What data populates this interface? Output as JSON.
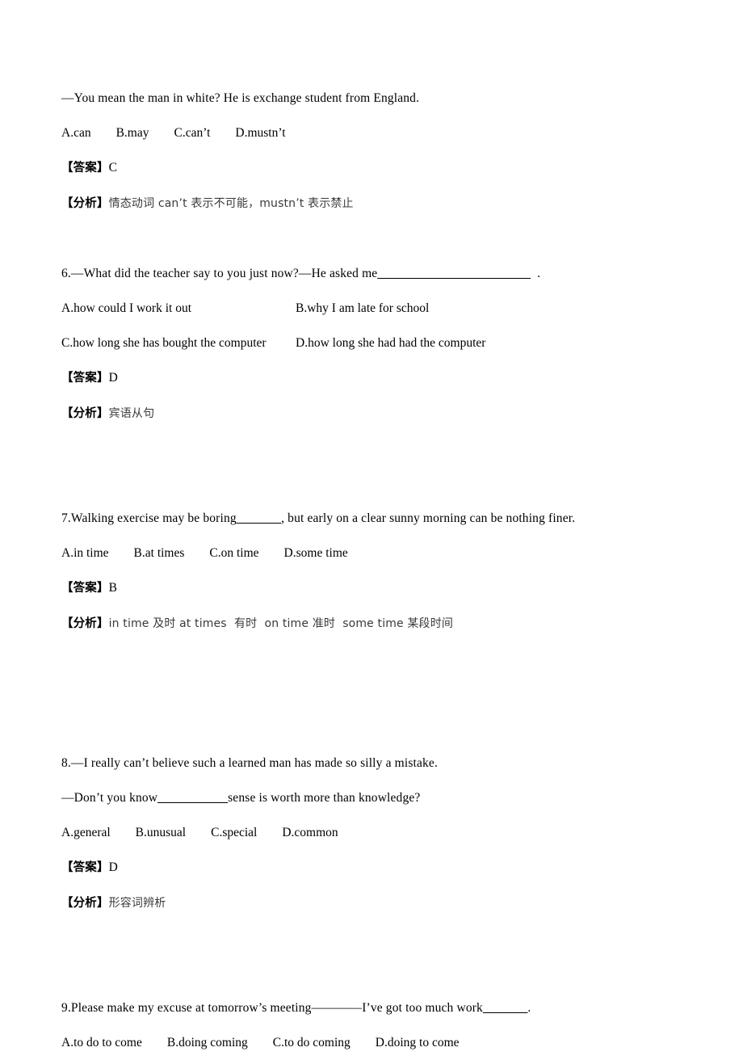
{
  "document": {
    "type": "english-exam-answer-key",
    "page_background": "#ffffff",
    "text_color": "#000000",
    "annotation_color": "#3a3a3a"
  },
  "labels": {
    "answer_marker": "【答案】",
    "analysis_marker": "【分析】"
  },
  "blocks": [
    {
      "id": "q5-continuation",
      "stem": "—You mean the man in white? He is exchange student from England.",
      "options_inline": "A.can　 B.may　 C.can’t　 D.mustn’t",
      "answer": "C",
      "analysis": "情态动词 can’t 表示不可能，mustn’t 表示禁止"
    },
    {
      "id": "q6",
      "stem_before_blank": "6.—What did the teacher say to you just now?—He asked me",
      "blank": "________________________",
      "stem_after_blank": "  .",
      "options_grid": [
        {
          "a": "A.how could I work it out",
          "b": "B.why I am late for school"
        },
        {
          "a": "C.how long she has bought the computer",
          "b": "D.how long she had had the computer"
        }
      ],
      "answer": "D",
      "analysis": "宾语从句"
    },
    {
      "id": "q7",
      "stem_before_blank": "7.Walking exercise may be boring",
      "blank": "_______",
      "stem_after_blank": ", but early on a clear sunny morning can be nothing finer.",
      "options_inline": "A.in time　 B.at times　 C.on time　 D.some time",
      "answer": "B",
      "analysis": "in time 及时 at times  有时  on time 准时  some time 某段时间"
    },
    {
      "id": "q8",
      "stem_line1": "8.—I really can’t believe such a learned man has made so silly a mistake.",
      "stem_line2_before_blank": "—Don’t you know",
      "blank": "___________",
      "stem_line2_after_blank": "sense is worth more than knowledge?",
      "options_inline": "A.general　 B.unusual　 C.special　 D.common",
      "answer": "D",
      "analysis": "形容词辨析"
    },
    {
      "id": "q9",
      "stem_before_blank": "9.Please make my excuse at tomorrow’s meeting————I’ve got too much work",
      "blank": "_______",
      "stem_after_blank": ".",
      "options_inline": "A.to do to come　 B.doing coming　 C.to do coming　 D.doing to come"
    }
  ]
}
